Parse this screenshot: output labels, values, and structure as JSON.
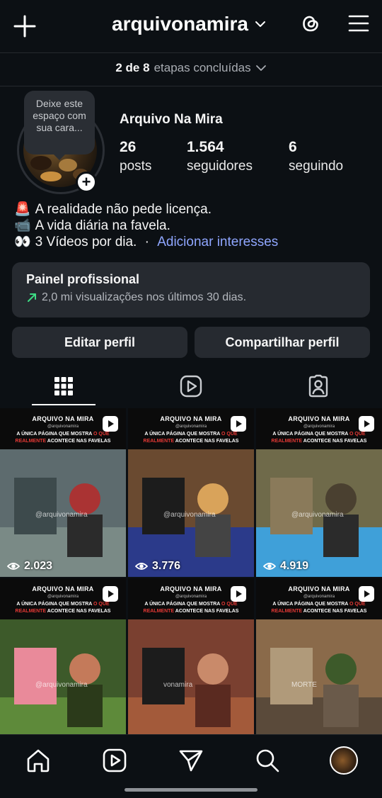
{
  "header": {
    "username": "arquivonamira"
  },
  "steps": {
    "count": "2 de 8",
    "label": "etapas concluídas"
  },
  "profile": {
    "bubble_text": "Deixe este espaço com sua cara...",
    "display_name": "Arquivo Na Mira",
    "stats": [
      {
        "value": "26",
        "label": "posts"
      },
      {
        "value": "1.564",
        "label": "seguidores"
      },
      {
        "value": "6",
        "label": "seguindo"
      }
    ],
    "bio": [
      {
        "emoji": "🚨",
        "text": "A realidade não pede licença."
      },
      {
        "emoji": "📹",
        "text": "A vida diária na favela."
      },
      {
        "emoji": "👀",
        "text": "3 Vídeos por dia.",
        "separator": " · ",
        "link": "Adicionar interesses"
      }
    ]
  },
  "panel": {
    "title": "Painel profissional",
    "subtitle": "2,0 mi visualizações nos últimos 30 dias."
  },
  "buttons": {
    "edit": "Editar perfil",
    "share": "Compartilhar perfil"
  },
  "grid": {
    "brand": "ARQUIVO NA MIRA",
    "handle": "@arquivonamira",
    "tag_line1_a": "A ÚNICA PÁGINA QUE MOSTRA",
    "tag_line1_b": "O QUE",
    "tag_line2_a": "REALMENTE",
    "tag_line2_b": "ACONTECE NAS FAVELAS",
    "posts": [
      {
        "views": "2.023",
        "watermark": "@arquivonamira"
      },
      {
        "views": "3.776",
        "watermark": "@arquivonamira"
      },
      {
        "views": "4.919",
        "watermark": "@arquivonamira"
      },
      {
        "views": "",
        "watermark": "@arquivonamira"
      },
      {
        "views": "",
        "watermark": "vonamira"
      },
      {
        "views": "",
        "watermark": "MORTE"
      }
    ]
  }
}
